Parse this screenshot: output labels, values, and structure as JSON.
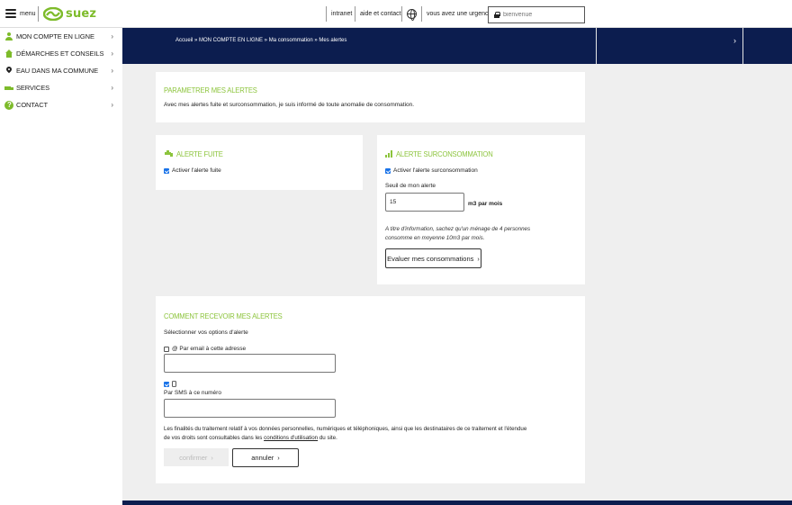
{
  "header": {
    "menu_label": "menu",
    "logo_text": "suez",
    "links": {
      "intranet": "intranet",
      "help": "aide et contact",
      "urgence": "vous avez une urgence ?"
    },
    "search_placeholder": "bienvenue"
  },
  "sidebar": {
    "items": [
      {
        "label": "MON COMPTE EN LIGNE",
        "icon": "user-icon"
      },
      {
        "label": "DÉMARCHES ET CONSEILS",
        "icon": "house-icon"
      },
      {
        "label": "EAU DANS MA COMMUNE",
        "icon": "pin-icon"
      },
      {
        "label": "SERVICES",
        "icon": "truck-icon"
      },
      {
        "label": "CONTACT",
        "icon": "help-icon"
      }
    ]
  },
  "breadcrumb": "Accueil » MON COMPTE EN LIGNE » Ma consommation » Mes alertes",
  "intro": {
    "title": "PARAMETRER MES ALERTES",
    "text": "Avec mes alertes fuite et surconsommation, je suis informé de toute anomalie de consommation."
  },
  "fuite": {
    "title": "ALERTE FUITE",
    "checkbox_label": "Activer l'alerte fuite",
    "checked": true
  },
  "surconso": {
    "title": "ALERTE SURCONSOMMATION",
    "checkbox_label": "Activer l'alerte surconsommation",
    "checked": true,
    "threshold_label": "Seuil de mon alerte",
    "threshold_value": "15",
    "unit": "m3 par mois",
    "info_line1": "A titre d'information, sachez qu'un ménage de 4 personnes",
    "info_line2": "consomme en moyenne 10m3 par mois.",
    "evaluate_button": "Evaluer mes consommations"
  },
  "receive": {
    "title": "COMMENT RECEVOIR MES ALERTES",
    "subtitle": "Sélectionner vos options d'alerte",
    "email_label": "@ Par email à cette adresse",
    "email_checked": false,
    "email_value": "",
    "sms_label": "Par SMS à ce numéro",
    "sms_checked": true,
    "sms_value": "",
    "legal_line1": "Les finalités du traitement relatif à vos données personnelles, numériques et téléphoniques, ainsi que les destinataires de ce traitement et l'étendue",
    "legal_line2_pre": "de vos droits sont consultables dans les",
    "legal_link": "conditions d'utilisation",
    "legal_line2_post": "du site.",
    "confirm_button": "confirmer",
    "cancel_button": "annuler"
  },
  "colors": {
    "brand_green": "#7dbb2a",
    "navy": "#0c1d4f",
    "background": "#efefef"
  }
}
